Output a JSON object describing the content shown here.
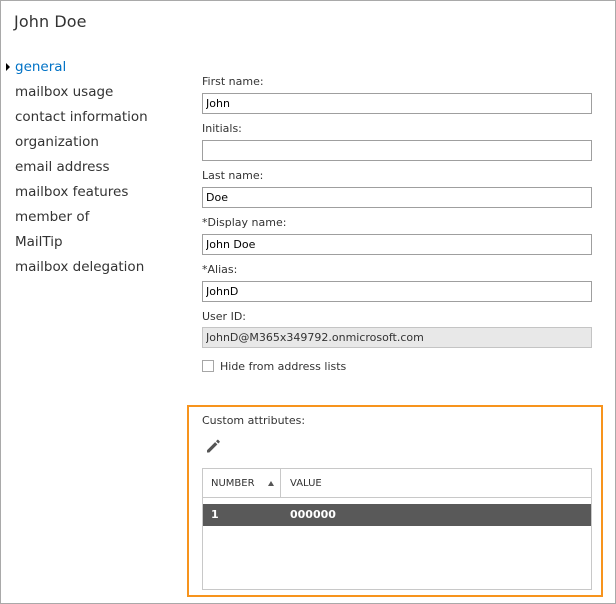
{
  "page": {
    "title": "John Doe"
  },
  "nav": {
    "items": [
      {
        "label": "general",
        "selected": true
      },
      {
        "label": "mailbox usage"
      },
      {
        "label": "contact information"
      },
      {
        "label": "organization"
      },
      {
        "label": "email address"
      },
      {
        "label": "mailbox features"
      },
      {
        "label": "member of"
      },
      {
        "label": "MailTip"
      },
      {
        "label": "mailbox delegation"
      }
    ]
  },
  "form": {
    "first_name": {
      "label": "First name:",
      "value": "John"
    },
    "initials": {
      "label": "Initials:",
      "value": ""
    },
    "last_name": {
      "label": "Last name:",
      "value": "Doe"
    },
    "display_name": {
      "label": "*Display name:",
      "value": "John Doe"
    },
    "alias": {
      "label": "*Alias:",
      "value": "JohnD"
    },
    "user_id": {
      "label": "User ID:",
      "value": "JohnD@M365x349792.onmicrosoft.com"
    },
    "hide_from_address_lists": {
      "label": "Hide from address lists",
      "checked": false
    }
  },
  "custom_attributes": {
    "label": "Custom attributes:",
    "edit_icon": "pencil-icon",
    "columns": {
      "number": "NUMBER",
      "value": "VALUE"
    },
    "sort_icon": "sort-ascending-icon",
    "rows": [
      {
        "number": "1",
        "value": "000000"
      }
    ]
  },
  "colors": {
    "accent": "#0072c6",
    "highlight_border": "#f7941d",
    "selected_row_bg": "#595959"
  }
}
